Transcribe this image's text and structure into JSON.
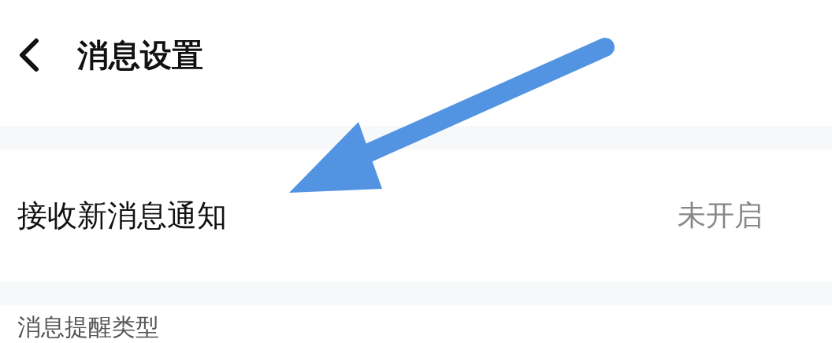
{
  "header": {
    "title": "消息设置"
  },
  "settings": [
    {
      "label": "接收新消息通知",
      "value": "未开启"
    }
  ],
  "section": {
    "title": "消息提醒类型"
  }
}
